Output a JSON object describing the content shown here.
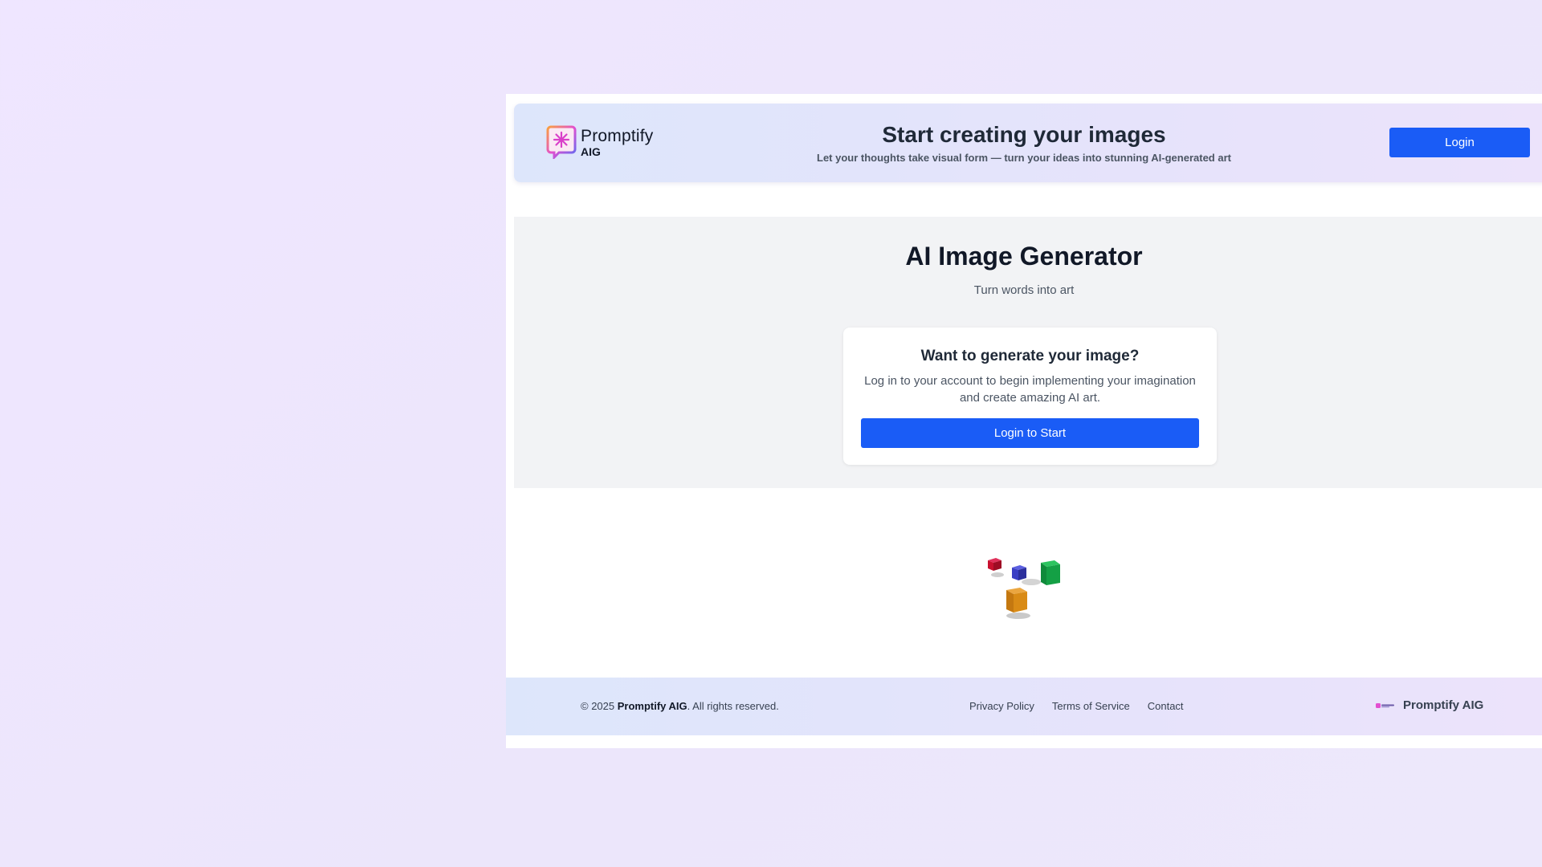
{
  "brand": {
    "name": "Promptify",
    "sub": "AIG",
    "footer_name": "Promptify AIG"
  },
  "header": {
    "title": "Start creating your images",
    "subtitle": "Let your thoughts take visual form — turn your ideas into stunning AI-generated art",
    "login_label": "Login"
  },
  "generator": {
    "title": "AI Image Generator",
    "subtitle": "Turn words into art",
    "card": {
      "title": "Want to generate your image?",
      "text": "Log in to your account to begin implementing your imagination and create amazing AI art.",
      "button_label": "Login to Start"
    }
  },
  "footer": {
    "copyright_prefix": "© 2025 ",
    "copyright_brand": "Promptify AIG",
    "copyright_suffix": ". All rights reserved.",
    "links": [
      "Privacy Policy",
      "Terms of Service",
      "Contact"
    ]
  },
  "colors": {
    "primary": "#1a5cf6",
    "cube_red": "#c8102e",
    "cube_blue": "#3b3fc4",
    "cube_green": "#14a045",
    "cube_orange": "#d98b16"
  }
}
